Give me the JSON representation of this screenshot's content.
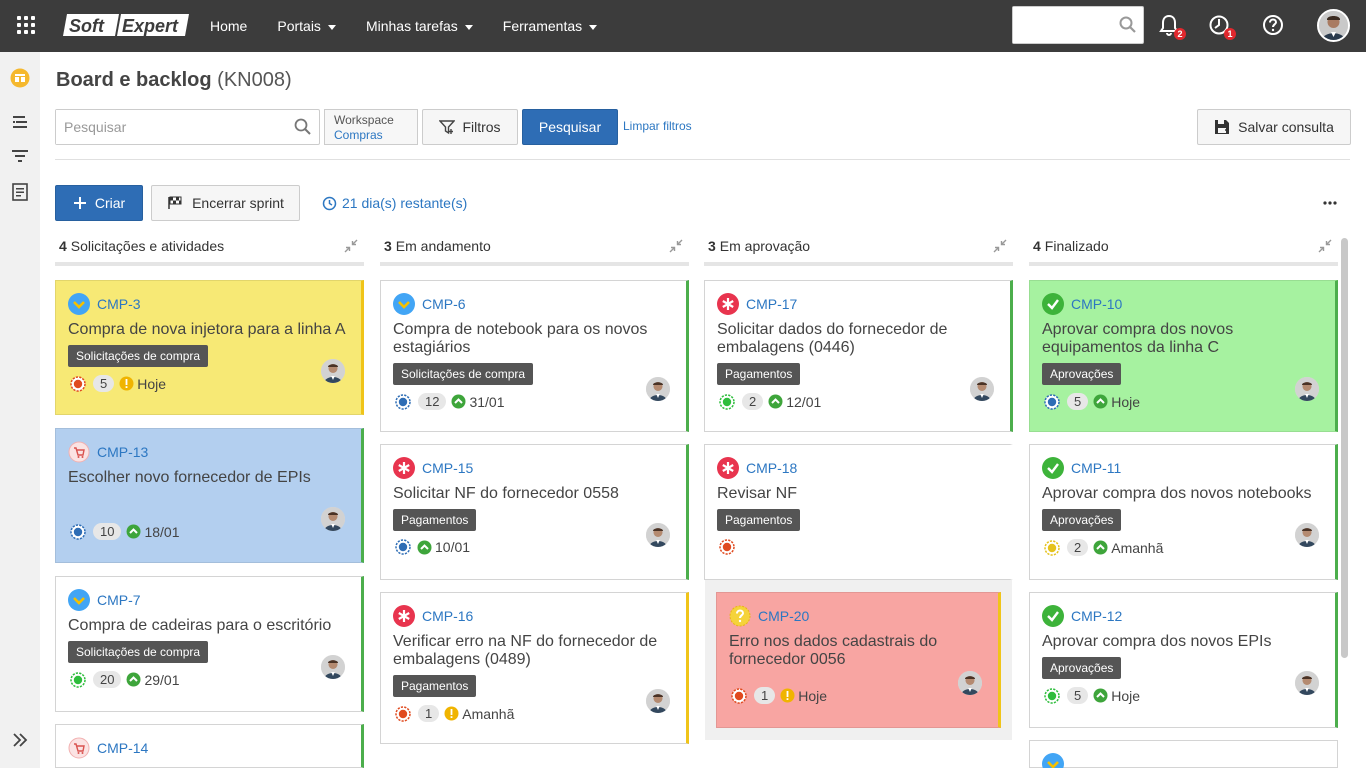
{
  "topbar": {
    "logo_text_soft": "Soft",
    "logo_text_expert": "Expert",
    "nav": [
      {
        "label": "Home",
        "dropdown": false
      },
      {
        "label": "Portais",
        "dropdown": true
      },
      {
        "label": "Minhas tarefas",
        "dropdown": true
      },
      {
        "label": "Ferramentas",
        "dropdown": true
      }
    ],
    "search_placeholder": "",
    "notifications_count": "2",
    "tasks_count": "1"
  },
  "page": {
    "title": "Board e backlog",
    "code": "(KN008)"
  },
  "filters": {
    "search_placeholder": "Pesquisar",
    "workspace_label": "Workspace",
    "workspace_value": "Compras",
    "filters_label": "Filtros",
    "search_button": "Pesquisar",
    "clear_label": "Limpar filtros",
    "save_label": "Salvar consulta"
  },
  "toolbar": {
    "create_label": "Criar",
    "end_sprint_label": "Encerrar sprint",
    "days_remaining": "21 dia(s) restante(s)"
  },
  "colors": {
    "accent": "#2e6db5",
    "link": "#2c77c2",
    "yellow_card": "#f7e975",
    "blue_card": "#b3cfef",
    "green_card": "#a6f2a0",
    "red_card": "#f8a5a2"
  },
  "columns": [
    {
      "count": "4",
      "name": "Solicitações e atividades",
      "cards": [
        {
          "id": "CMP-3",
          "title": "Compra de nova injetora para a linha A",
          "tag": "Solicitações de compra",
          "points": "5",
          "due": "Hoje",
          "type": "story-icon",
          "prio": "red",
          "due_kind": "warn",
          "bg": "yellow",
          "bar": "yellow"
        },
        {
          "id": "CMP-13",
          "title": "Escolher novo fornecedor de EPIs",
          "tag": "",
          "points": "10",
          "due": "18/01",
          "type": "cart-icon",
          "prio": "blue",
          "due_kind": "ok",
          "bg": "blue",
          "bar": "green"
        },
        {
          "id": "CMP-7",
          "title": "Compra de cadeiras para o escritório",
          "tag": "Solicitações de compra",
          "points": "20",
          "due": "29/01",
          "type": "story-icon",
          "prio": "green",
          "due_kind": "ok",
          "bg": "white",
          "bar": "green"
        },
        {
          "id": "CMP-14",
          "title": "",
          "tag": "",
          "points": "",
          "due": "",
          "type": "cart-icon",
          "prio": "",
          "due_kind": "",
          "bg": "white",
          "bar": "green"
        }
      ]
    },
    {
      "count": "3",
      "name": "Em andamento",
      "cards": [
        {
          "id": "CMP-6",
          "title": "Compra de notebook para os novos estagiários",
          "tag": "Solicitações de compra",
          "points": "12",
          "due": "31/01",
          "type": "story-icon",
          "prio": "blue",
          "due_kind": "ok",
          "bg": "white",
          "bar": "green"
        },
        {
          "id": "CMP-15",
          "title": "Solicitar NF do fornecedor 0558",
          "tag": "Pagamentos",
          "points": "",
          "due": "10/01",
          "type": "bug-icon",
          "prio": "blue",
          "due_kind": "ok",
          "bg": "white",
          "bar": "green"
        },
        {
          "id": "CMP-16",
          "title": "Verificar erro na NF do fornecedor de embalagens (0489)",
          "tag": "Pagamentos",
          "points": "1",
          "due": "Amanhã",
          "type": "bug-icon",
          "prio": "red",
          "due_kind": "warn",
          "bg": "white",
          "bar": "yellow"
        }
      ]
    },
    {
      "count": "3",
      "name": "Em aprovação",
      "cards": [
        {
          "id": "CMP-17",
          "title": "Solicitar dados do fornecedor de embalagens (0446)",
          "tag": "Pagamentos",
          "points": "2",
          "due": "12/01",
          "type": "bug-icon",
          "prio": "green",
          "due_kind": "ok",
          "bg": "white",
          "bar": "green"
        },
        {
          "id": "CMP-18",
          "title": "Revisar NF",
          "tag": "Pagamentos",
          "points": "",
          "due": "",
          "type": "bug-icon",
          "prio": "red",
          "due_kind": "",
          "bg": "white",
          "bar": "none"
        },
        {
          "id": "CMP-20",
          "title": "Erro nos dados cadastrais do fornecedor 0056",
          "tag": "",
          "points": "1",
          "due": "Hoje",
          "type": "question-icon",
          "prio": "red",
          "due_kind": "warn",
          "bg": "red",
          "bar": "yellow"
        }
      ]
    },
    {
      "count": "4",
      "name": "Finalizado",
      "cards": [
        {
          "id": "CMP-10",
          "title": "Aprovar compra dos novos equipamentos da linha C",
          "tag": "Aprovações",
          "points": "5",
          "due": "Hoje",
          "type": "check-icon",
          "prio": "blue",
          "due_kind": "ok",
          "bg": "green",
          "bar": "green"
        },
        {
          "id": "CMP-11",
          "title": "Aprovar compra dos novos notebooks",
          "tag": "Aprovações",
          "points": "2",
          "due": "Amanhã",
          "type": "check-icon",
          "prio": "yellow",
          "due_kind": "ok",
          "bg": "white",
          "bar": "green"
        },
        {
          "id": "CMP-12",
          "title": "Aprovar compra dos novos EPIs",
          "tag": "Aprovações",
          "points": "5",
          "due": "Hoje",
          "type": "check-icon",
          "prio": "green",
          "due_kind": "ok",
          "bg": "white",
          "bar": "green"
        }
      ]
    }
  ]
}
